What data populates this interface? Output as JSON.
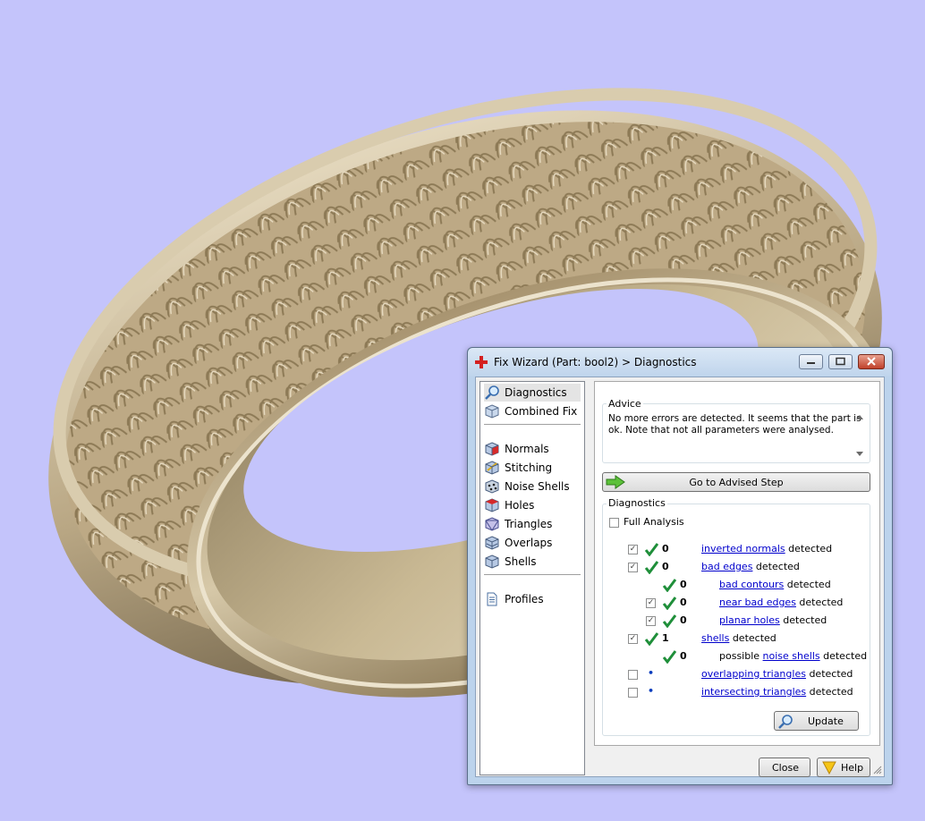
{
  "window": {
    "title": "Fix Wizard (Part: bool2) > Diagnostics"
  },
  "nav": {
    "items": [
      {
        "label": "Diagnostics",
        "icon": "magnifier-icon",
        "selected": true
      },
      {
        "label": "Combined Fix",
        "icon": "cube-icon"
      },
      {
        "label": "Normals",
        "icon": "normals-cube-icon"
      },
      {
        "label": "Stitching",
        "icon": "stitching-cube-icon"
      },
      {
        "label": "Noise Shells",
        "icon": "noise-shells-icon"
      },
      {
        "label": "Holes",
        "icon": "holes-cube-icon"
      },
      {
        "label": "Triangles",
        "icon": "triangles-cube-icon"
      },
      {
        "label": "Overlaps",
        "icon": "overlaps-cube-icon"
      },
      {
        "label": "Shells",
        "icon": "shells-cube-icon"
      },
      {
        "label": "Profiles",
        "icon": "document-icon"
      }
    ]
  },
  "advice": {
    "label": "Advice",
    "text": "No more errors are detected. It seems that the part is ok. Note that not all parameters were analysed."
  },
  "advised_step_label": "Go to Advised Step",
  "diagnostics": {
    "label": "Diagnostics",
    "full_analysis_label": "Full Analysis",
    "full_analysis_checked": false,
    "rows": [
      {
        "checked": true,
        "value": "0",
        "prefix": "",
        "link": "inverted normals",
        "suffix": " detected"
      },
      {
        "checked": true,
        "value": "0",
        "prefix": "",
        "link": "bad edges",
        "suffix": " detected"
      },
      {
        "value": "0",
        "prefix": "",
        "link": "bad contours",
        "suffix": " detected"
      },
      {
        "checked": true,
        "value": "0",
        "prefix": "",
        "link": "near bad edges",
        "suffix": " detected"
      },
      {
        "checked": true,
        "value": "0",
        "prefix": "",
        "link": "planar holes",
        "suffix": " detected"
      },
      {
        "checked": true,
        "value": "1",
        "prefix": "",
        "link": "shells",
        "suffix": " detected"
      },
      {
        "value": "0",
        "prefix": "possible ",
        "link": "noise shells",
        "suffix": " detected"
      },
      {
        "checked": false,
        "value": "•",
        "prefix": "",
        "link": "overlapping triangles",
        "suffix": " detected"
      },
      {
        "checked": false,
        "value": "•",
        "prefix": "",
        "link": "intersecting triangles",
        "suffix": " detected"
      }
    ]
  },
  "buttons": {
    "update": "Update",
    "close": "Close",
    "help": "Help"
  },
  "colors": {
    "background": "#c4c4fb",
    "ring": "#c7b89a",
    "link": "#0000cc",
    "check": "#1f8f3a"
  }
}
